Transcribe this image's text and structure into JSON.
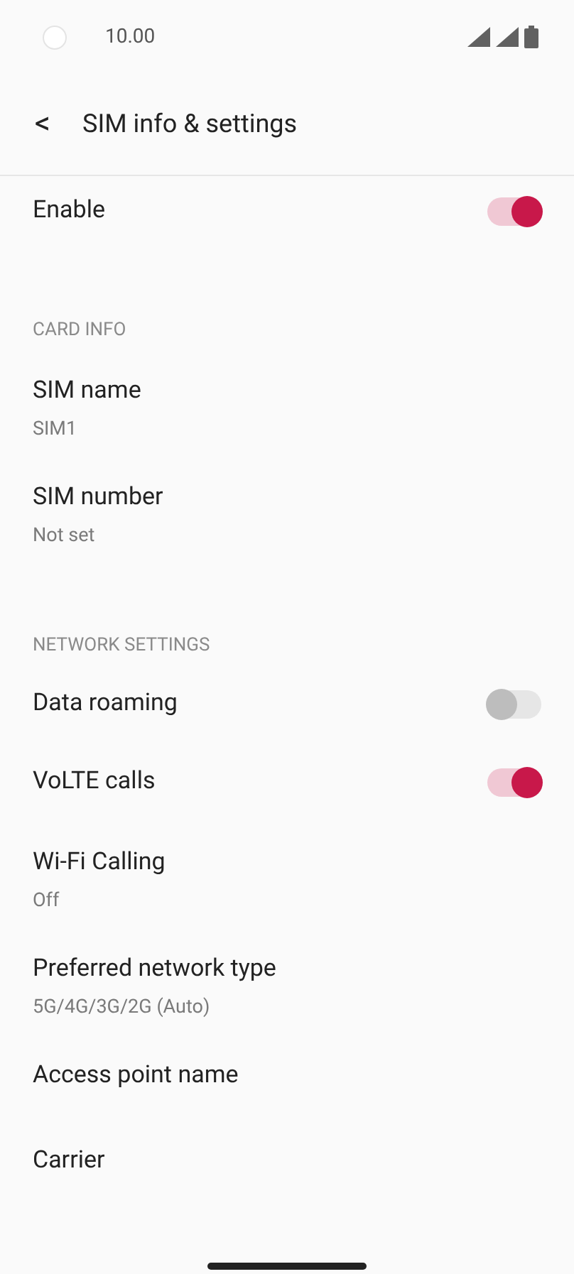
{
  "status_bar": {
    "time": "10.00"
  },
  "title_bar": {
    "back_icon": "<",
    "title": "SIM info & settings"
  },
  "sections": [
    {
      "items": [
        {
          "kind": "toggle",
          "title": "Enable",
          "on": true
        }
      ]
    },
    {
      "header": "CARD INFO",
      "items": [
        {
          "kind": "detail",
          "title": "SIM name",
          "subtitle": "SIM1"
        },
        {
          "kind": "detail",
          "title": "SIM number",
          "subtitle": "Not set"
        }
      ]
    },
    {
      "header": "NETWORK SETTINGS",
      "items": [
        {
          "kind": "toggle",
          "title": "Data roaming",
          "on": false
        },
        {
          "kind": "toggle",
          "title": "VoLTE calls",
          "on": true
        },
        {
          "kind": "detail",
          "title": "Wi-Fi Calling",
          "subtitle": "Off"
        },
        {
          "kind": "detail",
          "title": "Preferred network type",
          "subtitle": "5G/4G/3G/2G (Auto)"
        },
        {
          "kind": "plain",
          "title": "Access point name"
        },
        {
          "kind": "plain",
          "title": "Carrier"
        }
      ]
    }
  ]
}
